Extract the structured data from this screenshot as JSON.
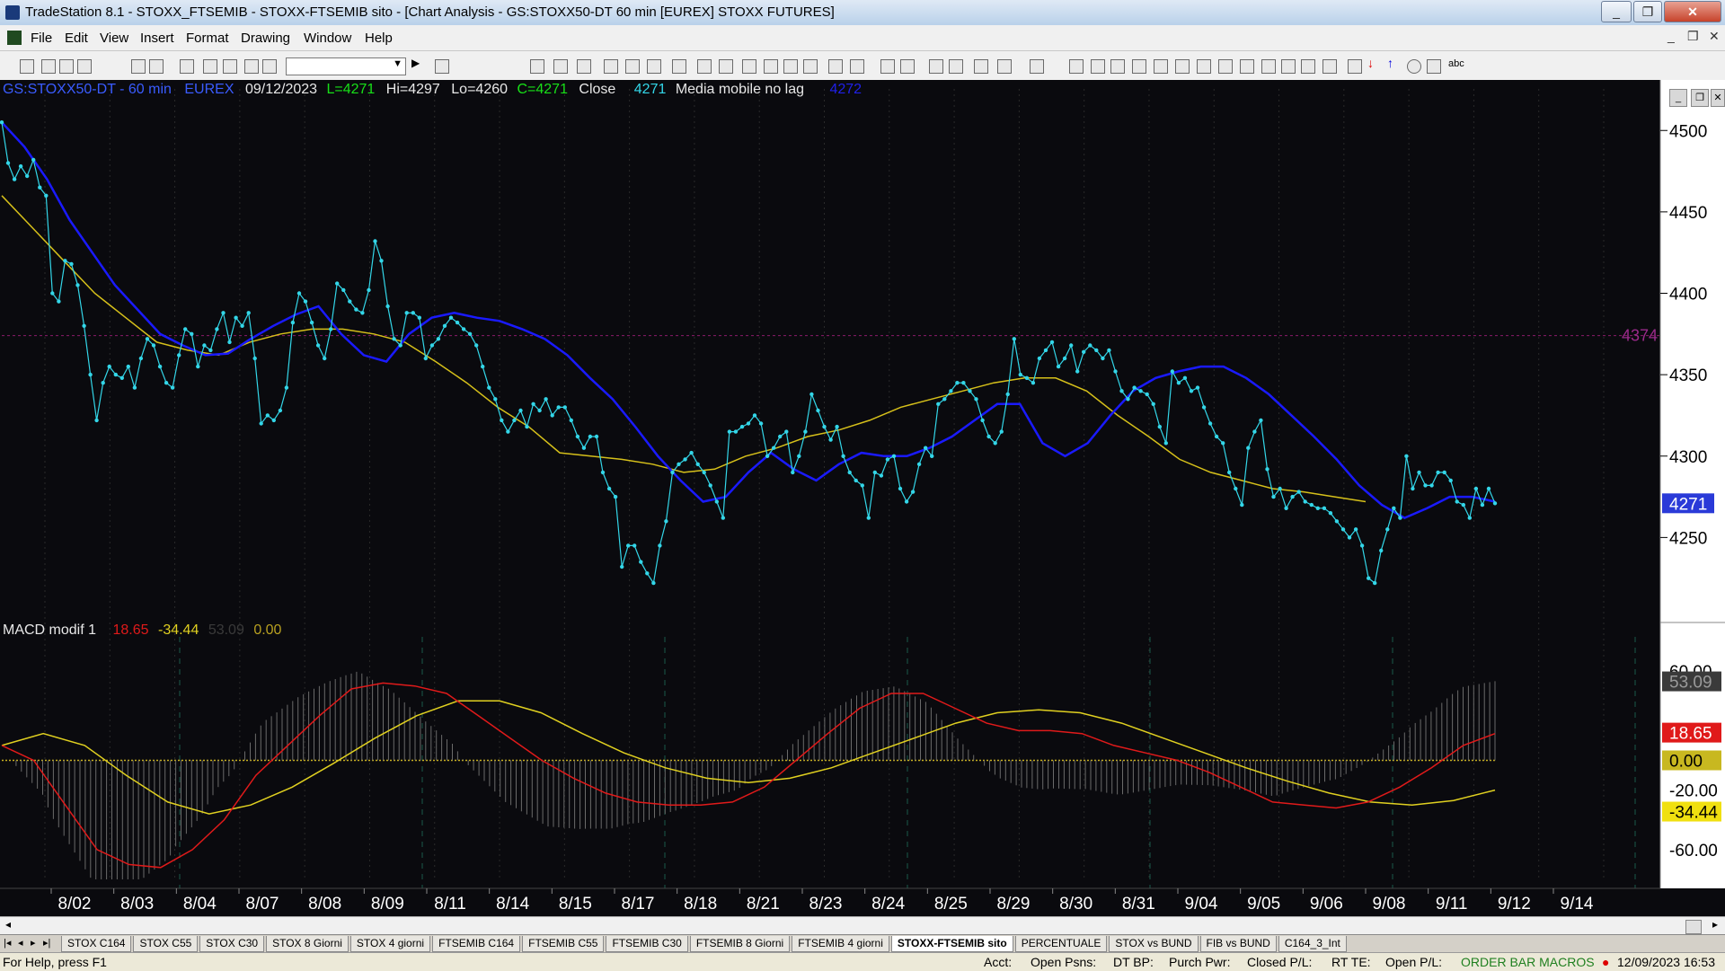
{
  "window": {
    "title": "TradeStation 8.1 - STOXX_FTSEMIB - STOXX-FTSEMIB sito - [Chart Analysis - GS:STOXX50-DT  60 min  [EUREX] STOXX FUTURES]",
    "minimize": "_",
    "restore": "❐",
    "close": "✕"
  },
  "menu": {
    "items": [
      "File",
      "Edit",
      "View",
      "Insert",
      "Format",
      "Drawing",
      "Window",
      "Help"
    ],
    "mdi_min": "_",
    "mdi_restore": "❐",
    "mdi_close": "✕"
  },
  "toolbar": {
    "combo_value": ""
  },
  "chart_header": {
    "symbol": "GS:STOXX50-DT - 60 min",
    "exchange": "EUREX",
    "date": "09/12/2023",
    "low_last": "L=4271",
    "high": "Hi=4297",
    "low": "Lo=4260",
    "close_val": "C=4271",
    "close_label": "Close",
    "close_number": "4271",
    "indicator_name": "Media mobile no lag",
    "indicator_value": "4272"
  },
  "macd_header": {
    "name": "MACD modif 1",
    "v1": "18.65",
    "v2": "-34.44",
    "v3": "53.09",
    "v4": "0.00"
  },
  "price_axis": {
    "labels": [
      "4500",
      "4450",
      "4400",
      "4350",
      "4300",
      "4250"
    ],
    "current": "4271",
    "line_label": "4374"
  },
  "macd_axis": {
    "labels": [
      "60.00",
      "-20.00",
      "-60.00"
    ],
    "tags": [
      "53.09",
      "18.65",
      "0.00",
      "-34.44"
    ]
  },
  "date_axis": [
    "8/02",
    "8/03",
    "8/04",
    "8/07",
    "8/08",
    "8/09",
    "8/11",
    "8/14",
    "8/15",
    "8/17",
    "8/18",
    "8/21",
    "8/23",
    "8/24",
    "8/25",
    "8/29",
    "8/30",
    "8/31",
    "9/04",
    "9/05",
    "9/06",
    "9/08",
    "9/11",
    "9/12",
    "9/14"
  ],
  "colors": {
    "background": "#0a0a0e",
    "price": "#33d6e8",
    "ma_fast": "#1a1aff",
    "ma_slow": "#d6c01a",
    "macd": "#e01a1a",
    "signal": "#e0d020",
    "histogram": "#6a6a6a",
    "level_line": "#8a1a6a"
  },
  "chart_data": {
    "type": "line",
    "price_series": [
      4505,
      4480,
      4470,
      4478,
      4472,
      4482,
      4465,
      4460,
      4400,
      4395,
      4420,
      4418,
      4405,
      4380,
      4350,
      4322,
      4345,
      4355,
      4350,
      4348,
      4355,
      4342,
      4360,
      4372,
      4368,
      4355,
      4345,
      4342,
      4362,
      4378,
      4375,
      4355,
      4368,
      4365,
      4378,
      4388,
      4370,
      4385,
      4380,
      4388,
      4360,
      4320,
      4325,
      4322,
      4328,
      4342,
      4382,
      4400,
      4395,
      4382,
      4368,
      4360,
      4378,
      4406,
      4402,
      4395,
      4390,
      4388,
      4402,
      4432,
      4420,
      4392,
      4372,
      4368,
      4388,
      4388,
      4385,
      4360,
      4368,
      4372,
      4380,
      4385,
      4382,
      4378,
      4375,
      4368,
      4355,
      4342,
      4335,
      4322,
      4315,
      4322,
      4328,
      4318,
      4332,
      4328,
      4335,
      4325,
      4330,
      4330,
      4322,
      4312,
      4305,
      4312,
      4312,
      4290,
      4280,
      4275,
      4232,
      4245,
      4245,
      4235,
      4228,
      4222,
      4245,
      4260,
      4290,
      4295,
      4298,
      4302,
      4295,
      4290,
      4282,
      4272,
      4262,
      4315,
      4315,
      4318,
      4320,
      4325,
      4320,
      4300,
      4305,
      4312,
      4315,
      4290,
      4300,
      4315,
      4338,
      4328,
      4318,
      4310,
      4318,
      4300,
      4290,
      4285,
      4282,
      4262,
      4290,
      4288,
      4298,
      4300,
      4280,
      4272,
      4278,
      4295,
      4305,
      4300,
      4332,
      4335,
      4340,
      4345,
      4345,
      4340,
      4335,
      4322,
      4312,
      4308,
      4315,
      4338,
      4372,
      4350,
      4348,
      4345,
      4360,
      4365,
      4370,
      4355,
      4360,
      4368,
      4352,
      4364,
      4368,
      4365,
      4360,
      4365,
      4352,
      4340,
      4335,
      4342,
      4340,
      4338,
      4332,
      4318,
      4308,
      4352,
      4345,
      4348,
      4340,
      4342,
      4330,
      4320,
      4312,
      4308,
      4290,
      4280,
      4270,
      4305,
      4315,
      4322,
      4292,
      4275,
      4280,
      4268,
      4275,
      4278,
      4272,
      4270,
      4268,
      4268,
      4265,
      4260,
      4255,
      4250,
      4255,
      4245,
      4225,
      4222,
      4242,
      4255,
      4268,
      4262,
      4300,
      4280,
      4290,
      4282,
      4282,
      4290,
      4290,
      4285,
      4272,
      4270,
      4262,
      4280,
      4270,
      4280,
      4271
    ],
    "ma_fast": [
      4505,
      4490,
      4470,
      4445,
      4425,
      4405,
      4390,
      4375,
      4368,
      4362,
      4363,
      4372,
      4380,
      4387,
      4392,
      4375,
      4362,
      4358,
      4375,
      4385,
      4388,
      4385,
      4383,
      4378,
      4372,
      4362,
      4348,
      4335,
      4318,
      4300,
      4285,
      4272,
      4275,
      4290,
      4302,
      4292,
      4285,
      4295,
      4302,
      4300,
      4300,
      4305,
      4312,
      4322,
      4332,
      4332,
      4308,
      4300,
      4308,
      4325,
      4340,
      4348,
      4352,
      4355,
      4355,
      4348,
      4338,
      4325,
      4312,
      4298,
      4282,
      4270,
      4262,
      4268,
      4275,
      4275,
      4272
    ],
    "ma_slow": [
      4460,
      4440,
      4420,
      4400,
      4385,
      4370,
      4365,
      4362,
      4370,
      4375,
      4378,
      4378,
      4375,
      4370,
      4358,
      4345,
      4330,
      4318,
      4302,
      4300,
      4298,
      4295,
      4290,
      4292,
      4300,
      4305,
      4312,
      4316,
      4322,
      4330,
      4335,
      4340,
      4345,
      4348,
      4348,
      4340,
      4325,
      4312,
      4298,
      4290,
      4285,
      4280,
      4278,
      4275,
      4272
    ],
    "macd": [
      10,
      0,
      -30,
      -60,
      -70,
      -72,
      -60,
      -40,
      -10,
      10,
      30,
      48,
      52,
      50,
      45,
      30,
      15,
      0,
      -12,
      -22,
      -28,
      -30,
      -30,
      -28,
      -18,
      0,
      18,
      35,
      45,
      45,
      35,
      25,
      20,
      20,
      18,
      10,
      5,
      0,
      -8,
      -18,
      -28,
      -30,
      -32,
      -28,
      -18,
      -5,
      10,
      18
    ],
    "signal": [
      10,
      18,
      10,
      -10,
      -28,
      -36,
      -30,
      -18,
      -2,
      15,
      30,
      40,
      40,
      32,
      18,
      5,
      -5,
      -12,
      -15,
      -12,
      -5,
      5,
      15,
      25,
      32,
      34,
      32,
      25,
      15,
      5,
      -5,
      -14,
      -22,
      -28,
      -30,
      -27,
      -20
    ],
    "histogram_peak": 53.09,
    "price_ylim": [
      4200,
      4520
    ],
    "macd_ylim": [
      -80,
      80
    ],
    "grid": false,
    "level_line": 4374
  }
}
